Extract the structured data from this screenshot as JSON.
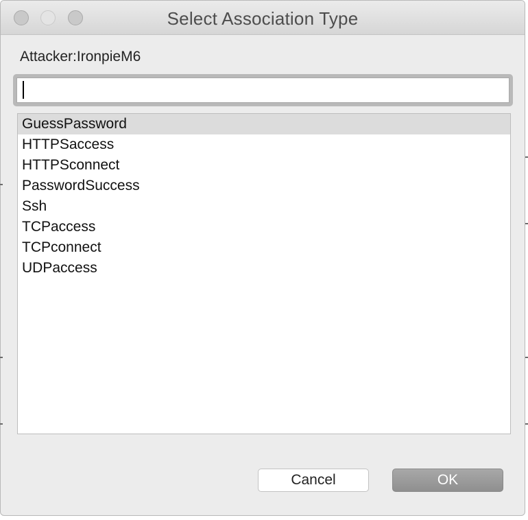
{
  "window": {
    "title": "Select Association Type"
  },
  "dialog": {
    "subject_label": "Attacker:IronpieM6",
    "search": {
      "value": "",
      "placeholder": ""
    },
    "list": {
      "selected_index": 0,
      "items": [
        {
          "label": "GuessPassword"
        },
        {
          "label": "HTTPSaccess"
        },
        {
          "label": "HTTPSconnect"
        },
        {
          "label": "PasswordSuccess"
        },
        {
          "label": "Ssh"
        },
        {
          "label": "TCPaccess"
        },
        {
          "label": "TCPconnect"
        },
        {
          "label": "UDPaccess"
        }
      ]
    },
    "buttons": {
      "cancel_label": "Cancel",
      "ok_label": "OK"
    }
  },
  "colors": {
    "window_background": "#ececec",
    "selection": "#dcdcdc",
    "ok_button": "#9b9b9b"
  }
}
